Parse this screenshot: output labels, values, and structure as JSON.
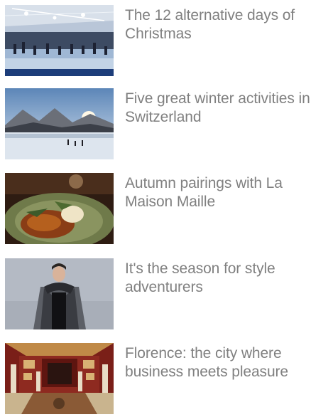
{
  "articles": [
    {
      "title": "The 12 alternative days of Christmas",
      "image": "ice-skating-rink-image"
    },
    {
      "title": "Five great winter activities in Switzerland",
      "image": "snowy-lake-mountains-image"
    },
    {
      "title": "Autumn pairings with La Maison Maille",
      "image": "roast-dish-plate-image"
    },
    {
      "title": "It's the season for style adventurers",
      "image": "man-in-coat-image"
    },
    {
      "title": "Florence: the city where business meets pleasure",
      "image": "florence-gallery-hall-image"
    }
  ],
  "colors": {
    "title_text": "#808080",
    "background": "#ffffff"
  }
}
